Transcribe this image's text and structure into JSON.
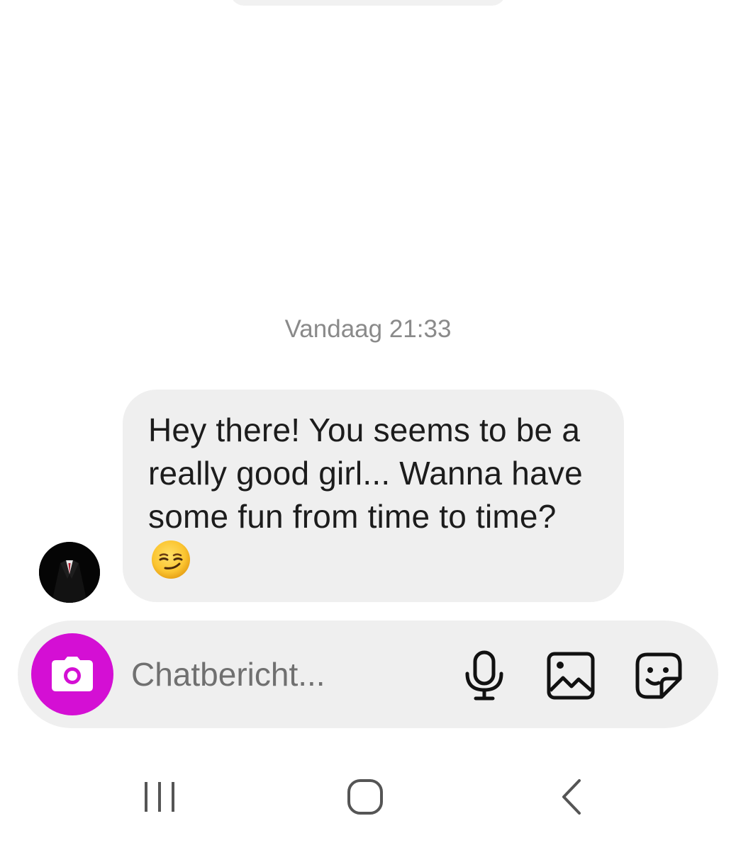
{
  "conversation": {
    "timestamp": "Vandaag 21:33",
    "messages": [
      {
        "sender": "other",
        "text": "Hey there! You seems to be a really good girl... Wanna have some fun from time to time?",
        "emoji": "smirking-face"
      }
    ]
  },
  "composer": {
    "placeholder": "Chatbericht...",
    "value": "",
    "camera_color": "#d40fd4",
    "icons": [
      "camera-icon",
      "microphone-icon",
      "gallery-icon",
      "sticker-icon"
    ]
  },
  "system_nav": {
    "icons": [
      "recent-apps-icon",
      "home-icon",
      "back-icon"
    ]
  }
}
